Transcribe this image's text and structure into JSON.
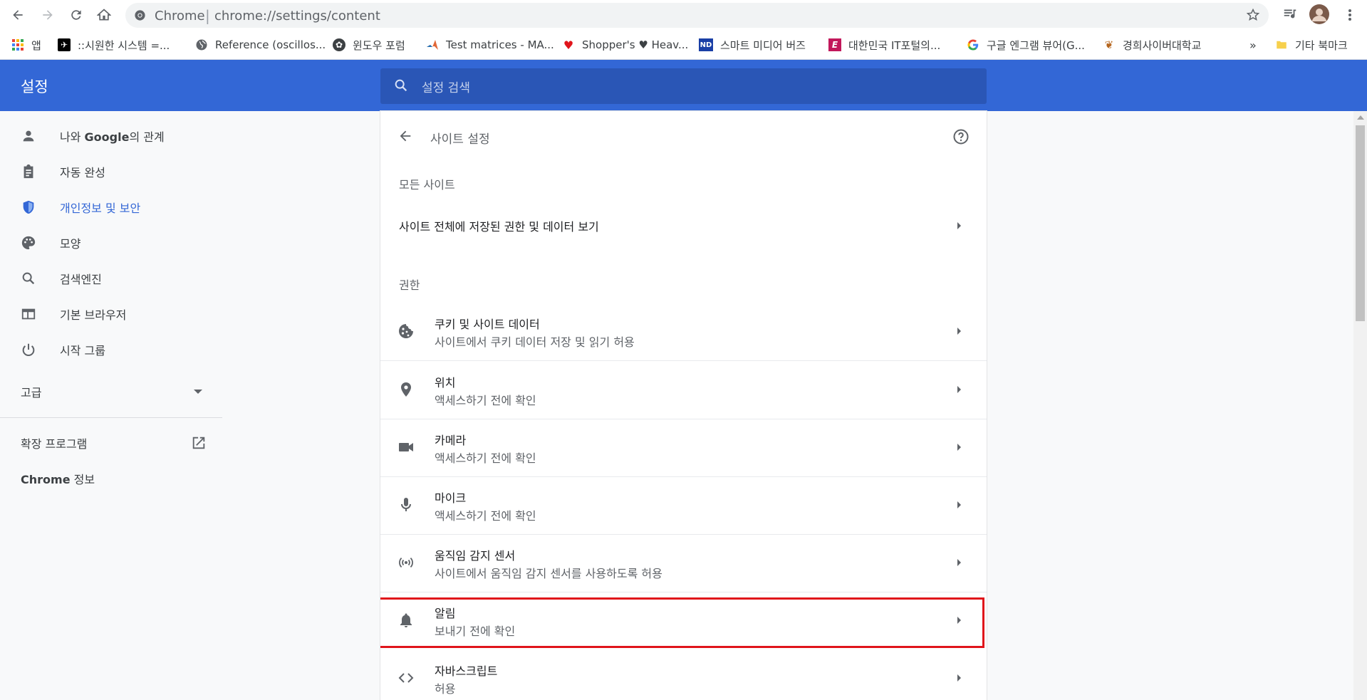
{
  "browser": {
    "brand": "Chrome",
    "url": "chrome://settings/content",
    "bookmarks": [
      {
        "label": "앱",
        "icon": "apps-grid-icon"
      },
      {
        "label": "::시원한 시스템 =...",
        "icon": "bookmark-favicon"
      },
      {
        "label": "Reference (oscillos...",
        "icon": "globe-icon"
      },
      {
        "label": "윈도우 포럼",
        "icon": "bookmark-favicon"
      },
      {
        "label": "Test matrices - MA...",
        "icon": "matlab-icon"
      },
      {
        "label": "Shopper's ♥ Heav...",
        "icon": "heart-icon"
      },
      {
        "label": "스마트 미디어 버즈",
        "icon": "bookmark-favicon"
      },
      {
        "label": "대한민국 IT포털의...",
        "icon": "bookmark-favicon"
      },
      {
        "label": "구글 엔그램 뷰어(G...",
        "icon": "google-icon"
      },
      {
        "label": "경희사이버대학교",
        "icon": "bookmark-favicon"
      }
    ],
    "overflow": "»",
    "other_bookmarks": "기타 북마크"
  },
  "header": {
    "title": "설정",
    "search_placeholder": "설정 검색"
  },
  "sidebar": {
    "items": [
      {
        "prefix": "나와 ",
        "bold": "Google",
        "suffix": "의 관계",
        "icon": "person-icon"
      },
      {
        "label": "자동 완성",
        "icon": "clipboard-icon"
      },
      {
        "label": "개인정보 및 보안",
        "icon": "shield-icon",
        "active": true
      },
      {
        "label": "모양",
        "icon": "palette-icon"
      },
      {
        "label": "검색엔진",
        "icon": "search-icon"
      },
      {
        "label": "기본 브라우저",
        "icon": "browser-icon"
      },
      {
        "label": "시작 그룹",
        "icon": "power-icon"
      }
    ],
    "advanced": "고급",
    "extensions": "확장 프로그램",
    "about_bold": "Chrome",
    "about_suffix": " 정보"
  },
  "main": {
    "title": "사이트 설정",
    "all_sites_heading": "모든 사이트",
    "all_sites_link": "사이트 전체에 저장된 권한 및 데이터 보기",
    "permissions_heading": "권한",
    "permissions": [
      {
        "title": "쿠키 및 사이트 데이터",
        "subtitle": "사이트에서 쿠키 데이터 저장 및 읽기 허용",
        "icon": "cookie-icon"
      },
      {
        "title": "위치",
        "subtitle": "액세스하기 전에 확인",
        "icon": "location-pin-icon"
      },
      {
        "title": "카메라",
        "subtitle": "액세스하기 전에 확인",
        "icon": "camera-icon"
      },
      {
        "title": "마이크",
        "subtitle": "액세스하기 전에 확인",
        "icon": "microphone-icon"
      },
      {
        "title": "움직임 감지 센서",
        "subtitle": "사이트에서 움직임 감지 센서를 사용하도록 허용",
        "icon": "motion-sensor-icon"
      },
      {
        "title": "알림",
        "subtitle": "보내기 전에 확인",
        "icon": "bell-icon",
        "highlighted": true
      },
      {
        "title": "자바스크립트",
        "subtitle": "허용",
        "icon": "code-icon"
      }
    ]
  },
  "colors": {
    "accent": "#3367d6",
    "header_bg": "#3367d6",
    "search_bg": "#2a56b6",
    "highlight": "#e0151b"
  }
}
